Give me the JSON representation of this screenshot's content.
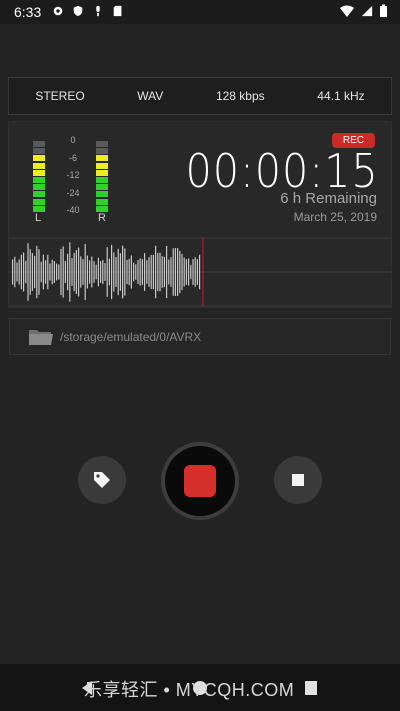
{
  "status_bar": {
    "time": "6:33",
    "icons_left": [
      "gear-icon",
      "shield-icon",
      "mic-icon",
      "sd-card-icon"
    ],
    "icons_right": [
      "wifi-icon",
      "signal-icon",
      "battery-icon"
    ]
  },
  "info_bar": {
    "channels": "STEREO",
    "format": "WAV",
    "bitrate": "128 kbps",
    "sample_rate": "44.1 kHz"
  },
  "meters": {
    "scale": [
      "0",
      "-6",
      "-12",
      "-24",
      "-40"
    ],
    "left_label": "L",
    "right_label": "R",
    "colors": {
      "off": "#5a5a5a",
      "yellow": "#ecec24",
      "green": "#2fd12a"
    }
  },
  "recording": {
    "badge": "REC",
    "timer": "00:00:15",
    "remaining": "6 h Remaining",
    "date": "March 25, 2019"
  },
  "waveform": {
    "playhead_color": "#c0201c",
    "wave_color": "#c8c8c8"
  },
  "storage": {
    "path": "/storage/emulated/0/AVRX"
  },
  "controls": {
    "tag_icon": "tag-icon",
    "record_icon": "record-stop-icon",
    "stop_icon": "stop-icon"
  },
  "nav": {
    "watermark": "乐享轻汇 • MYCQH.COM"
  }
}
